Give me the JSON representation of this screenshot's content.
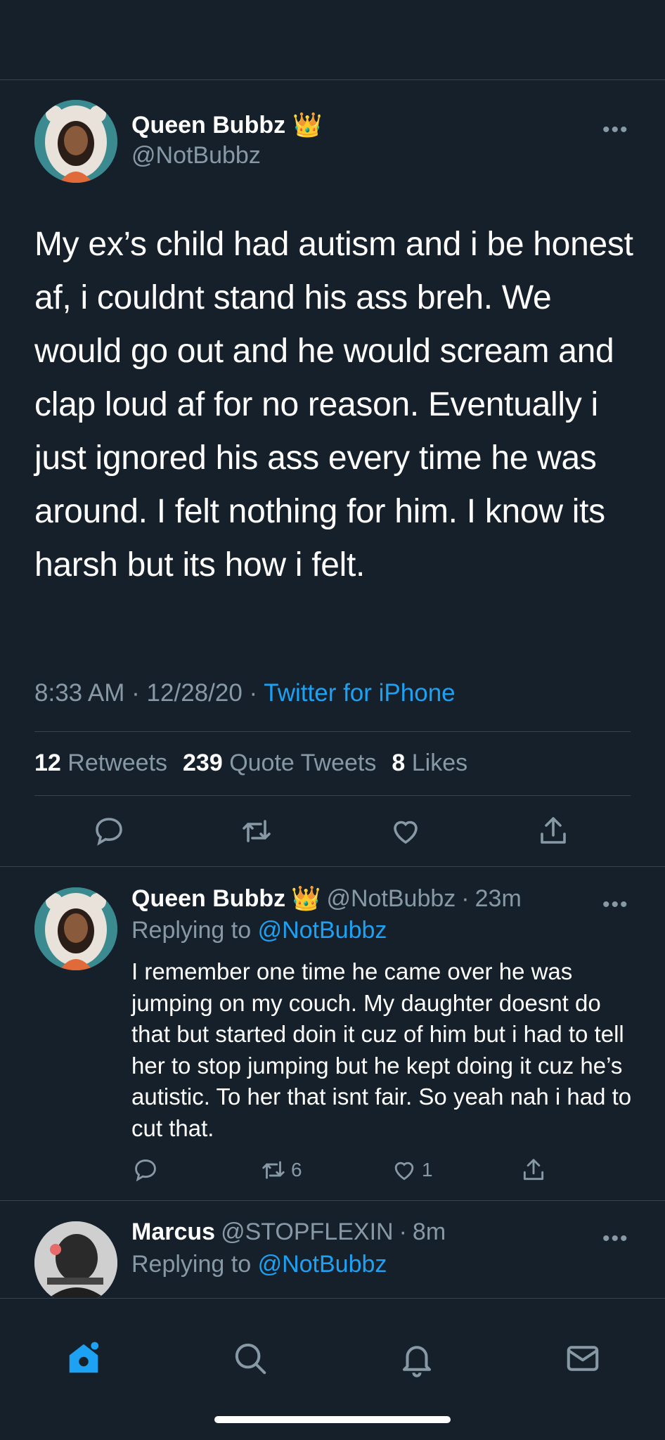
{
  "main_tweet": {
    "author_name": "Queen Bubbz",
    "author_emoji": "👑",
    "author_handle": "@NotBubbz",
    "text": "My ex’s child had autism and i be honest af, i couldnt stand his ass breh. We would go out and he would scream and clap loud af for no reason. Eventually i just ignored his ass every time he was around. I felt nothing for him. I know its harsh but its how i felt.",
    "time": "8:33 AM",
    "date": "12/28/20",
    "separator": "·",
    "source": "Twitter for iPhone",
    "retweets_count": "12",
    "retweets_label": "Retweets",
    "quote_count": "239",
    "quote_label": "Quote Tweets",
    "likes_count": "8",
    "likes_label": "Likes"
  },
  "replies": [
    {
      "author_name": "Queen Bubbz",
      "author_emoji": "👑",
      "author_handle": "@NotBubbz",
      "time": "23m",
      "replying_label": "Replying to",
      "replying_handle": "@NotBubbz",
      "text": "I remember one time he came over he was jumping on my couch. My daughter doesnt do that but started doin it cuz of him but i had to tell her to stop jumping but he kept doing it cuz he’s autistic. To her that isnt fair. So yeah nah i had to cut that.",
      "retweets": "6",
      "likes": "1"
    },
    {
      "author_name": "Marcus",
      "author_handle": "@STOPFLEXIN",
      "time": "8m",
      "replying_label": "Replying to",
      "replying_handle": "@NotBubbz"
    }
  ],
  "colors": {
    "background": "#15202b",
    "divider": "#38444d",
    "muted": "#8899a6",
    "link": "#1da1f2"
  },
  "icons": {
    "reply": "reply-icon",
    "retweet": "retweet-icon",
    "like": "heart-icon",
    "share": "share-icon",
    "more": "more-dots-icon",
    "home": "home-icon",
    "search": "search-icon",
    "notifications": "bell-icon",
    "messages": "mail-icon"
  }
}
